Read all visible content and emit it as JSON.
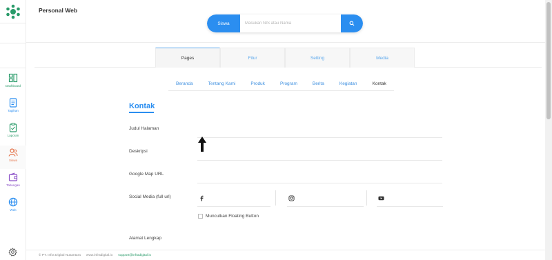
{
  "app": {
    "title": "Personal Web"
  },
  "search": {
    "category": "Siswa",
    "placeholder": "Masukan NIS atau Nama"
  },
  "sidebar": {
    "items": [
      {
        "label": "Dashboard",
        "icon": "dashboard-icon"
      },
      {
        "label": "Tagihan",
        "icon": "invoice-icon"
      },
      {
        "label": "Laporan",
        "icon": "report-icon"
      },
      {
        "label": "Siswa",
        "icon": "student-icon"
      },
      {
        "label": "Tabungan",
        "icon": "wallet-icon"
      },
      {
        "label": "Web",
        "icon": "globe-icon"
      }
    ],
    "settings_icon": "gear-icon"
  },
  "main_tabs": [
    {
      "label": "Pages",
      "active": true
    },
    {
      "label": "Fitur",
      "active": false
    },
    {
      "label": "Setting",
      "active": false
    },
    {
      "label": "Media",
      "active": false
    }
  ],
  "sub_tabs": [
    {
      "label": "Beranda",
      "active": false
    },
    {
      "label": "Tentang Kami",
      "active": false
    },
    {
      "label": "Produk",
      "active": false
    },
    {
      "label": "Program",
      "active": false
    },
    {
      "label": "Berita",
      "active": false
    },
    {
      "label": "Kegiatan",
      "active": false
    },
    {
      "label": "Kontak",
      "active": true
    }
  ],
  "form": {
    "title": "Kontak",
    "fields": {
      "judul": {
        "label": "Judul Halaman",
        "value": ""
      },
      "deskripsi": {
        "label": "Deskripsi",
        "value": ""
      },
      "map": {
        "label": "Google Map URL",
        "value": ""
      },
      "social": {
        "label": "Social Media (full url)",
        "facebook": "",
        "instagram": "",
        "youtube": ""
      },
      "floating": {
        "label": "Munculkan Floating Button",
        "checked": false
      },
      "alamat": {
        "label": "Alamat Lengkap",
        "value": ""
      }
    }
  },
  "footer": {
    "copyright": "© PT. Infra Digital Nusantara",
    "website": "www.infradigital.io",
    "email": "support@infradigital.io"
  },
  "colors": {
    "accent": "#2b8ef0",
    "brand_green": "#2a9b6a",
    "student_orange": "#e5744a",
    "wallet_purple": "#8a4fc7"
  }
}
